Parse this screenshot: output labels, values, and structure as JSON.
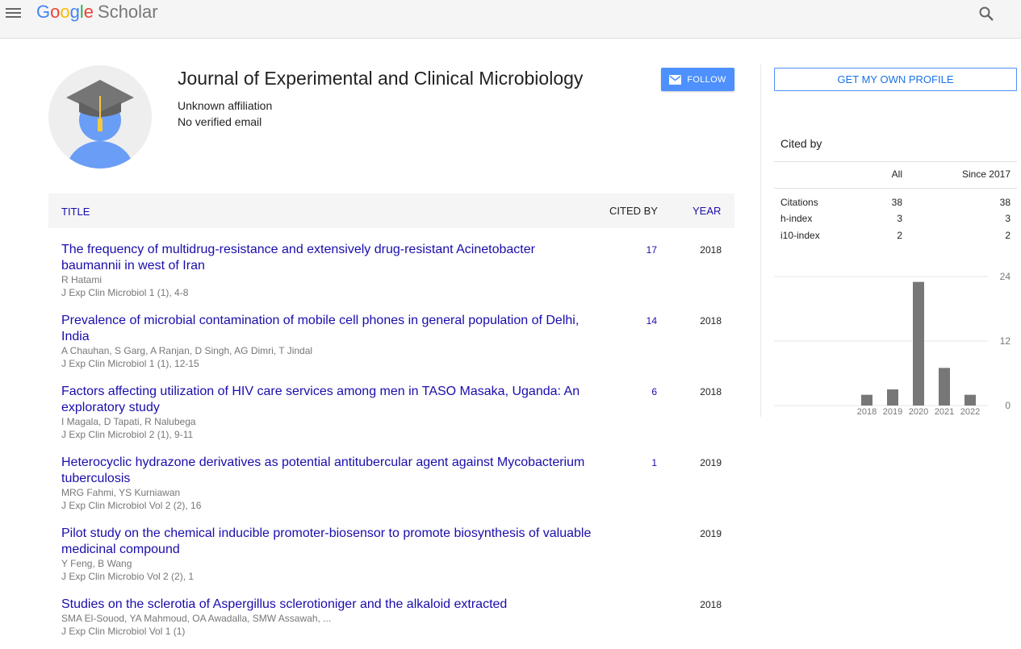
{
  "header": {
    "logo_letters": [
      "G",
      "o",
      "o",
      "g",
      "l",
      "e"
    ],
    "logo_suffix": "Scholar"
  },
  "profile": {
    "name": "Journal of Experimental and Clinical Microbiology",
    "affiliation": "Unknown affiliation",
    "email_status": "No verified email",
    "follow_label": "FOLLOW"
  },
  "table": {
    "col_title": "TITLE",
    "col_cited_by": "CITED BY",
    "col_year": "YEAR"
  },
  "publications": [
    {
      "title": "The frequency of multidrug-resistance and extensively drug-resistant Acinetobacter baumannii in west of Iran",
      "authors": "R Hatami",
      "venue": "J Exp Clin Microbiol 1 (1), 4-8",
      "cited_by": "17",
      "year": "2018"
    },
    {
      "title": "Prevalence of microbial contamination of mobile cell phones in general population of Delhi, India",
      "authors": "A Chauhan, S Garg, A Ranjan, D Singh, AG Dimri, T Jindal",
      "venue": "J Exp Clin Microbiol 1 (1), 12-15",
      "cited_by": "14",
      "year": "2018"
    },
    {
      "title": "Factors affecting utilization of HIV care services among men in TASO Masaka, Uganda: An exploratory study",
      "authors": "I Magala, D Tapati, R Nalubega",
      "venue": "J Exp Clin Microbiol 2 (1), 9-11",
      "cited_by": "6",
      "year": "2018"
    },
    {
      "title": "Heterocyclic hydrazone derivatives as potential antitubercular agent against Mycobacterium tuberculosis",
      "authors": "MRG Fahmi, YS Kurniawan",
      "venue": "J Exp Clin Microbiol Vol 2 (2), 16",
      "cited_by": "1",
      "year": "2019"
    },
    {
      "title": "Pilot study on the chemical inducible promoter-biosensor to promote biosynthesis of valuable medicinal compound",
      "authors": "Y Feng, B Wang",
      "venue": "J Exp Clin Microbio Vol 2 (2), 1",
      "cited_by": "",
      "year": "2019"
    },
    {
      "title": "Studies on the sclerotia of Aspergillus sclerotioniger and the alkaloid extracted",
      "authors": "SMA El-Souod, YA Mahmoud, OA Awadalla, SMW Assawah, ...",
      "venue": "J Exp Clin Microbiol Vol 1 (1)",
      "cited_by": "",
      "year": "2018"
    }
  ],
  "sidebar": {
    "own_profile_label": "GET MY OWN PROFILE",
    "cited_by_heading": "Cited by",
    "col_all": "All",
    "col_since": "Since 2017",
    "stats": [
      {
        "label": "Citations",
        "all": "38",
        "since": "38"
      },
      {
        "label": "h-index",
        "all": "3",
        "since": "3"
      },
      {
        "label": "i10-index",
        "all": "2",
        "since": "2"
      }
    ]
  },
  "chart_data": {
    "type": "bar",
    "categories": [
      "2018",
      "2019",
      "2020",
      "2021",
      "2022"
    ],
    "values": [
      2,
      3,
      23,
      7,
      2
    ],
    "ylim": [
      0,
      24
    ],
    "yticks": [
      0,
      12,
      24
    ],
    "grid": true,
    "bar_color": "#777777"
  },
  "colors": {
    "link": "#1a0dab",
    "accent": "#4d90fe",
    "avatar_head": "#6a9df6",
    "cap": "#757575",
    "tassel": "#f5c842"
  }
}
